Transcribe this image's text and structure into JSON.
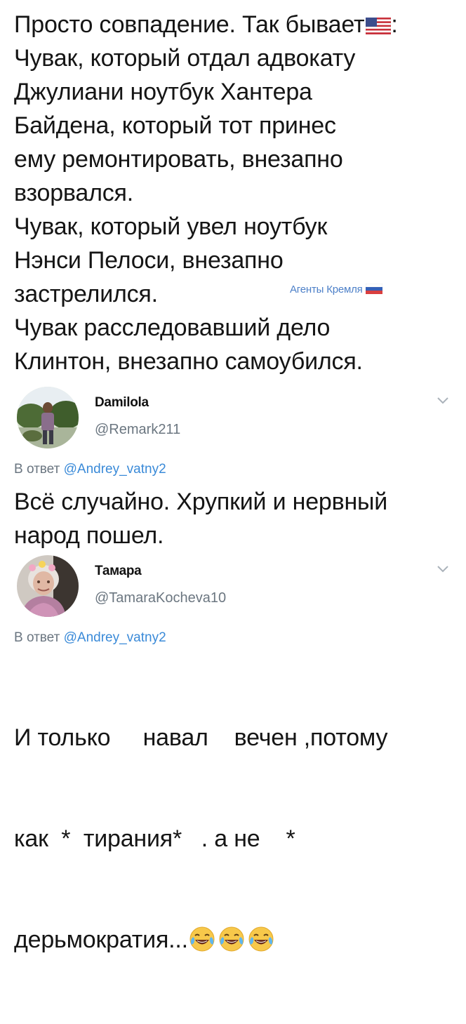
{
  "post": {
    "lines": [
      "Просто совпадение. Так бывает",
      "Чувак, который отдал адвокату",
      "Джулиани ноутбук Хантера",
      "Байдена, который тот принес",
      "ему ремонтировать, внезапно",
      "взорвался.",
      "Чувак, который увел ноутбук",
      "Нэнси Пелоси, внезапно",
      "застрелился.",
      "Чувак расследовавший дело",
      "Клинтон, внезапно самоубился."
    ],
    "line1_suffix": ":",
    "us_flag_icon": "us-flag-emoji",
    "watermark": "Агенты Кремля",
    "ru_flag_icon": "ru-flag-emoji"
  },
  "tweets": [
    {
      "name": "Damilola",
      "handle": "@Remark211",
      "reply_prefix": "В ответ",
      "reply_mention": "@Andrey_vatny2",
      "text_lines": [
        "Всё случайно. Хрупкий и нервный",
        "народ пошел."
      ]
    },
    {
      "name": "Тамара",
      "handle": "@TamaraKocheva10",
      "reply_prefix": "В ответ",
      "reply_mention": "@Andrey_vatny2",
      "text_lines": [
        "И только     навал    вечен ,потому",
        "как  *  тирания*   . а не    *",
        "дерьмократия..."
      ],
      "emoji": "face-with-tears-of-joy"
    }
  ],
  "colors": {
    "text": "#151515",
    "handle": "#6b7680",
    "mention": "#3a8ad8",
    "watermark": "#3a73c3"
  }
}
